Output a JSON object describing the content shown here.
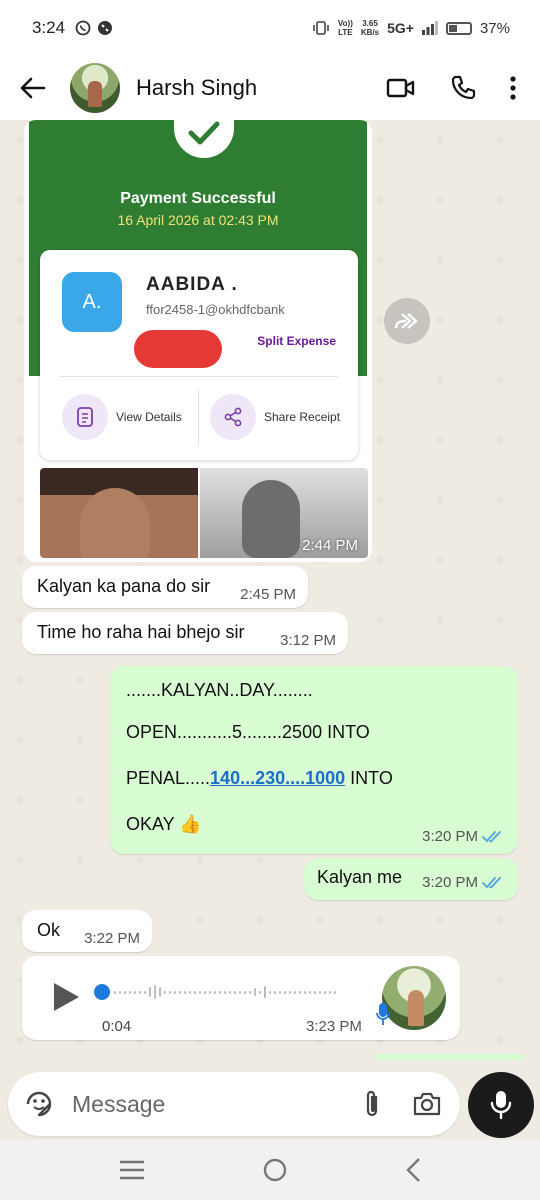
{
  "status_bar": {
    "time": "3:24",
    "volte_top": "Vo))",
    "volte_bottom": "LTE",
    "speed_value": "3.65",
    "speed_unit": "KB/s",
    "network": "5G+",
    "battery": "37%",
    "battery_level": 0.37
  },
  "header": {
    "contact_name": "Harsh Singh",
    "icons": [
      "back-arrow-icon",
      "video-call-icon",
      "phone-icon",
      "more-vertical-icon"
    ]
  },
  "payment_card": {
    "title": "Payment Successful",
    "date": "16 April 2026 at 02:43 PM",
    "recipient_initial": "A.",
    "recipient_name": "AABIDA .",
    "recipient_vpa": "ffor2458-1@okhdfcbank",
    "split_label": "Split Expense",
    "view_details": "View Details",
    "share_receipt": "Share Receipt",
    "time": "2:44 PM"
  },
  "messages": [
    {
      "dir": "in",
      "text": "Kalyan ka pana do sir",
      "time": "2:45 PM"
    },
    {
      "dir": "in",
      "text": "Time ho raha hai bhejo sir",
      "time": "3:12 PM"
    },
    {
      "dir": "out",
      "line1": ".......KALYAN..DAY........",
      "line2": "OPEN...........5........2500 INTO",
      "line3_prefix": "PENAL.....",
      "line3_link": "140...230....1000",
      "line3_suffix": " INTO",
      "line4": "OKAY",
      "line4_emoji": "👍",
      "time": "3:20 PM"
    },
    {
      "dir": "out",
      "text": "Kalyan me",
      "time": "3:20 PM"
    },
    {
      "dir": "in",
      "text": "Ok",
      "time": "3:22 PM"
    }
  ],
  "voice_message": {
    "duration": "0:04",
    "time": "3:23 PM",
    "progress": 0
  },
  "input": {
    "placeholder": "Message"
  },
  "colors": {
    "chat_bg": "#efeae2",
    "outgoing_bubble": "#d9fdd3",
    "payment_green": "#2f7d32",
    "read_ticks": "#4fa3e0"
  }
}
